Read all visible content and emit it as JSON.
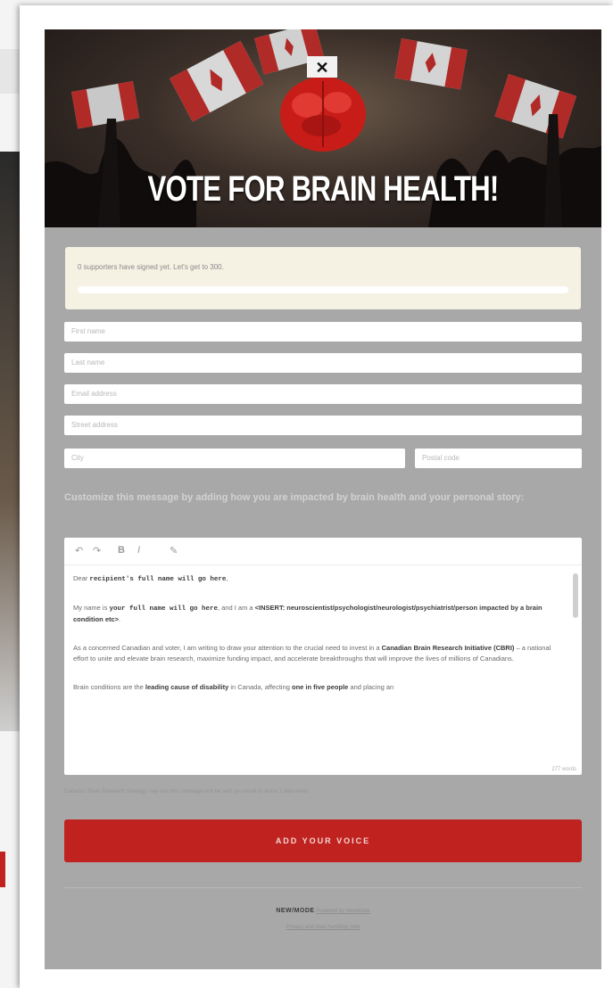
{
  "hero": {
    "title": "VOTE FOR BRAIN HEALTH!"
  },
  "progress": {
    "text": "0 supporters have signed yet. Let's get to 300.",
    "signed": 0,
    "goal": 300
  },
  "form": {
    "first_name_placeholder": "First name",
    "last_name_placeholder": "Last name",
    "email_placeholder": "Email address",
    "street_placeholder": "Street address",
    "city_placeholder": "City",
    "postal_placeholder": "Postal code",
    "customize_label": "Customize this message by adding how you are impacted by brain health and your personal story:"
  },
  "editor": {
    "toolbar": {
      "undo": "↶",
      "redo": "↷",
      "bold": "B",
      "italic": "I",
      "pen": "✎"
    },
    "message": {
      "p1_prefix": "Dear ",
      "p1_recipient": "recipient's full name will go here",
      "p1_suffix": ",",
      "p2_prefix": "My name is ",
      "p2_name": "your full name will go here",
      "p2_mid": ", and I am a ",
      "p2_insert": "<INSERT: neuroscientist/psychologist/neurologist/psychiatrist/person impacted by a brain condition etc>",
      "p2_suffix": ".",
      "p3_prefix": "As a concerned Canadian and voter, I am writing to draw your attention to the crucial need to invest in a ",
      "p3_bold": "Canadian Brain Research Initiative (CBRI)",
      "p3_suffix": " – a national effort to unite and elevate brain research, maximize funding impact, and accelerate breakthroughs that will improve the lives of millions of Canadians.",
      "p4_prefix": "Brain conditions are the ",
      "p4_bold1": "leading cause of disability",
      "p4_mid": " in Canada, affecting ",
      "p4_bold2": "one in five people",
      "p4_suffix": " and placing an"
    },
    "word_count": "277 words"
  },
  "note": "Canada's Brain Research Strategy may use this campaign and be sent you email to share 1 data news.",
  "submit_label": "ADD YOUR VOICE",
  "footer": {
    "brand": "NEW/MODE",
    "powered": "Powered by NewMode",
    "privacy": "Privacy and data handling note"
  },
  "colors": {
    "accent": "#c0231f",
    "panel": "#a8a8a8",
    "progress_bg": "#f5f1e3"
  },
  "icons": {
    "hero_brain": "brain-icon",
    "hero_flag": "x-flag-icon"
  }
}
